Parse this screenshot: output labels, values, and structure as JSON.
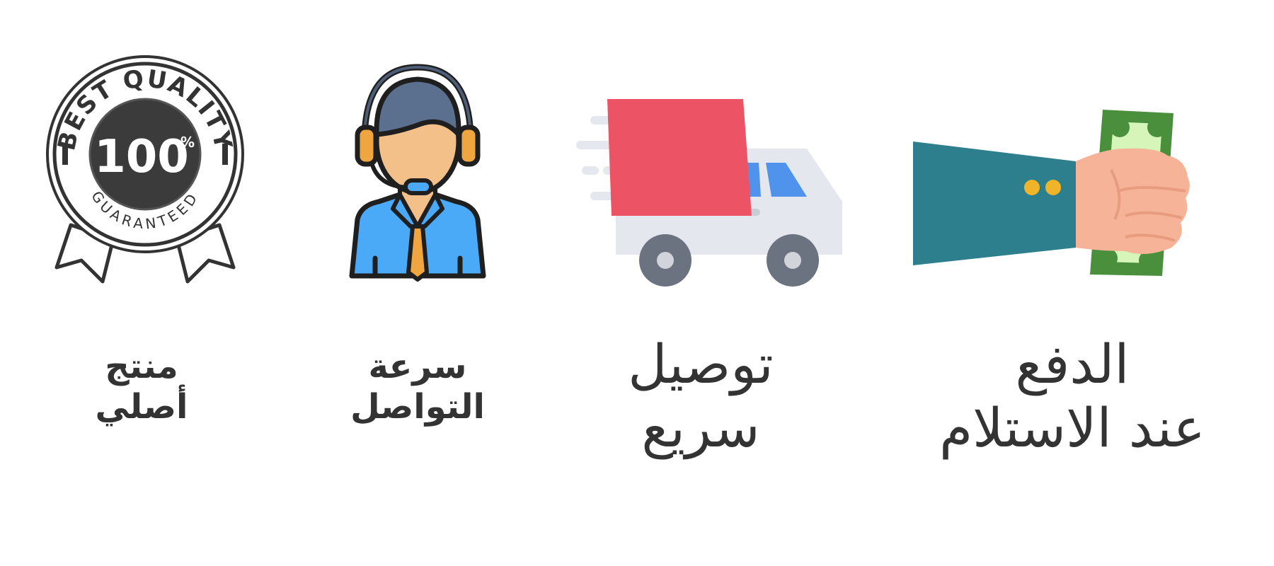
{
  "features": [
    {
      "icon": "best-quality-badge-icon",
      "badge_top_text": "BEST QUALITY",
      "badge_percent": "100",
      "badge_percent_sign": "%",
      "badge_bottom_text": "GUARANTEED",
      "line1": "منتج",
      "line2": "أصلي"
    },
    {
      "icon": "customer-support-agent-icon",
      "line1": "سرعة",
      "line2": "التواصل"
    },
    {
      "icon": "fast-delivery-truck-icon",
      "line1": "توصيل",
      "line2": "سريع"
    },
    {
      "icon": "cash-payment-hand-icon",
      "line1": "الدفع",
      "line2": "عند الاستلام"
    }
  ],
  "colors": {
    "text": "#333333",
    "truck_cargo": "#ec5466",
    "truck_cab": "#e4e7ee",
    "support_shirt": "#4aaaf7",
    "sleeve": "#2e7f8d",
    "cash_green": "#4a8f3c",
    "skin": "#f6b397"
  }
}
